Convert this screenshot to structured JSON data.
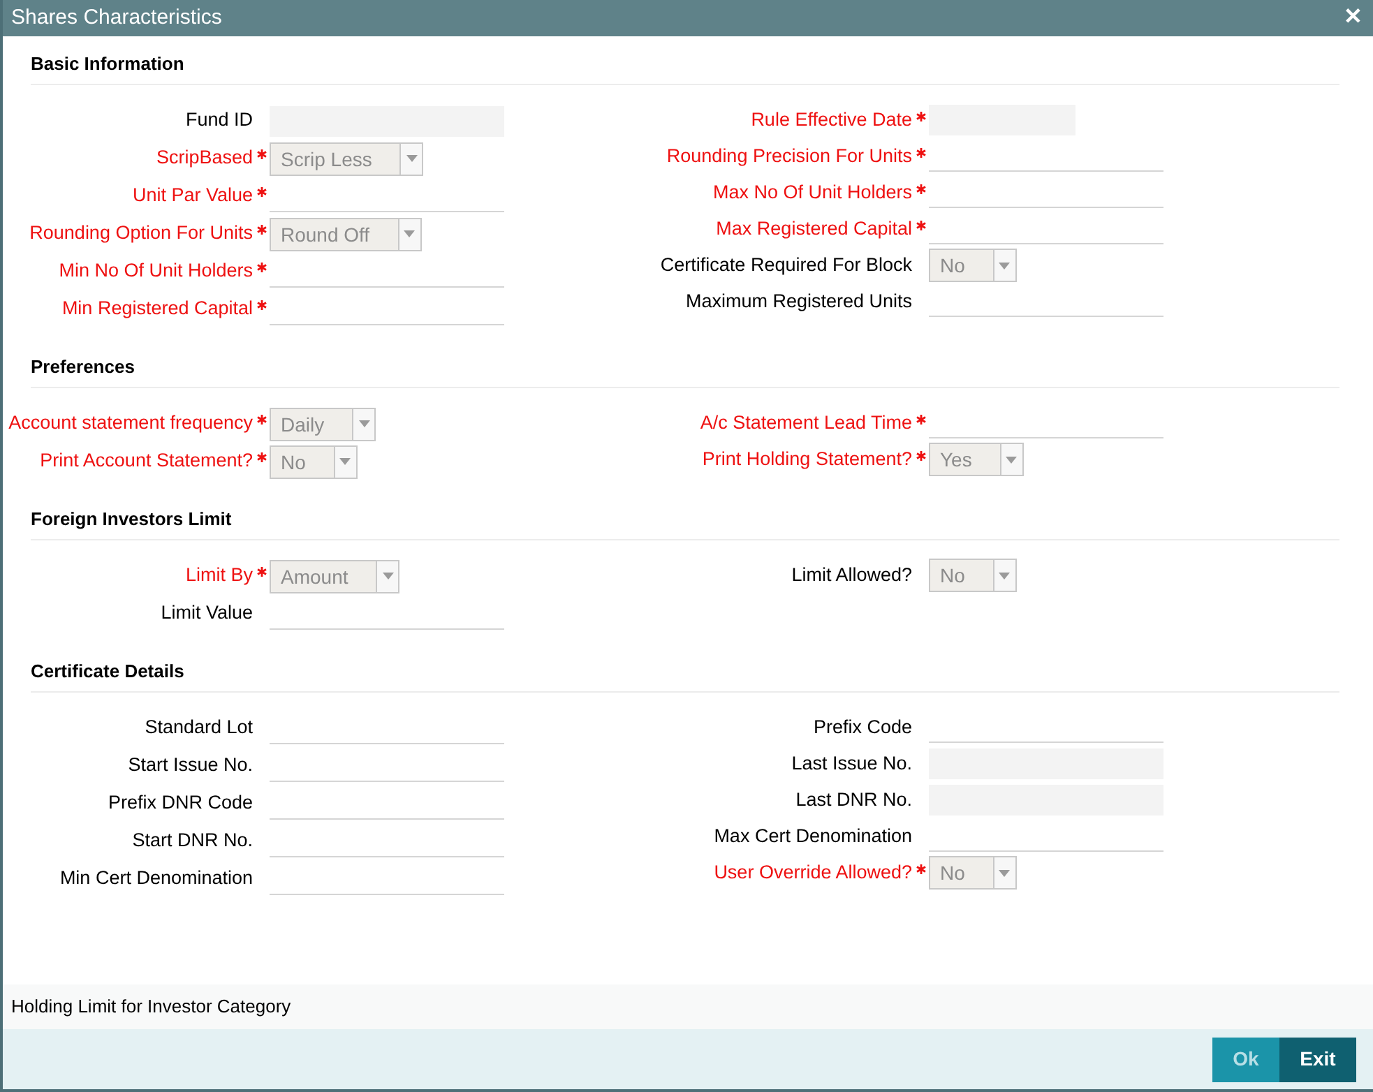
{
  "window": {
    "title": "Shares Characteristics",
    "close": "✕"
  },
  "sections": [
    {
      "title": "Basic Information",
      "left": [
        {
          "label": "Fund ID",
          "required": false,
          "kind": "readonly"
        },
        {
          "label": "ScripBased",
          "required": true,
          "kind": "select",
          "value": "Scrip Less"
        },
        {
          "label": "Unit Par Value",
          "required": true,
          "kind": "text"
        },
        {
          "label": "Rounding Option For Units",
          "required": true,
          "kind": "select",
          "value": "Round Off"
        },
        {
          "label": "Min No Of Unit Holders",
          "required": true,
          "kind": "text"
        },
        {
          "label": "Min Registered Capital",
          "required": true,
          "kind": "text"
        }
      ],
      "right": [
        {
          "label": "Rule Effective Date",
          "required": true,
          "kind": "date"
        },
        {
          "label": "Rounding Precision For Units",
          "required": true,
          "kind": "text"
        },
        {
          "label": "Max No Of Unit Holders",
          "required": true,
          "kind": "text"
        },
        {
          "label": "Max Registered Capital",
          "required": true,
          "kind": "text"
        },
        {
          "label": "Certificate Required For Block",
          "required": false,
          "kind": "select",
          "value": "No"
        },
        {
          "label": "Maximum Registered Units",
          "required": false,
          "kind": "text"
        }
      ]
    },
    {
      "title": "Preferences",
      "left": [
        {
          "label": "Account statement frequency",
          "required": true,
          "kind": "select",
          "value": "Daily"
        },
        {
          "label": "Print Account Statement?",
          "required": true,
          "kind": "select",
          "value": "No"
        }
      ],
      "right": [
        {
          "label": "A/c Statement Lead Time",
          "required": true,
          "kind": "text"
        },
        {
          "label": "Print Holding Statement?",
          "required": true,
          "kind": "select",
          "value": "Yes"
        }
      ]
    },
    {
      "title": "Foreign Investors Limit",
      "left": [
        {
          "label": "Limit By",
          "required": true,
          "kind": "select",
          "value": "Amount"
        },
        {
          "label": "Limit Value",
          "required": false,
          "kind": "text"
        }
      ],
      "right": [
        {
          "label": "Limit Allowed?",
          "required": false,
          "kind": "select",
          "value": "No"
        }
      ]
    },
    {
      "title": "Certificate Details",
      "left": [
        {
          "label": "Standard Lot",
          "required": false,
          "kind": "text"
        },
        {
          "label": "Start Issue No.",
          "required": false,
          "kind": "text"
        },
        {
          "label": "Prefix DNR Code",
          "required": false,
          "kind": "text"
        },
        {
          "label": "Start DNR No.",
          "required": false,
          "kind": "text"
        },
        {
          "label": "Min Cert Denomination",
          "required": false,
          "kind": "text"
        }
      ],
      "right": [
        {
          "label": "Prefix Code",
          "required": false,
          "kind": "text"
        },
        {
          "label": "Last Issue No.",
          "required": false,
          "kind": "readonly"
        },
        {
          "label": "Last DNR No.",
          "required": false,
          "kind": "readonly"
        },
        {
          "label": "Max Cert Denomination",
          "required": false,
          "kind": "text"
        },
        {
          "label": "User Override Allowed?",
          "required": true,
          "kind": "select",
          "value": "No"
        }
      ]
    }
  ],
  "subsection_link": "Holding Limit for Investor Category",
  "buttons": [
    {
      "label": "Ok",
      "disabled": true
    },
    {
      "label": "Exit",
      "disabled": false
    }
  ]
}
